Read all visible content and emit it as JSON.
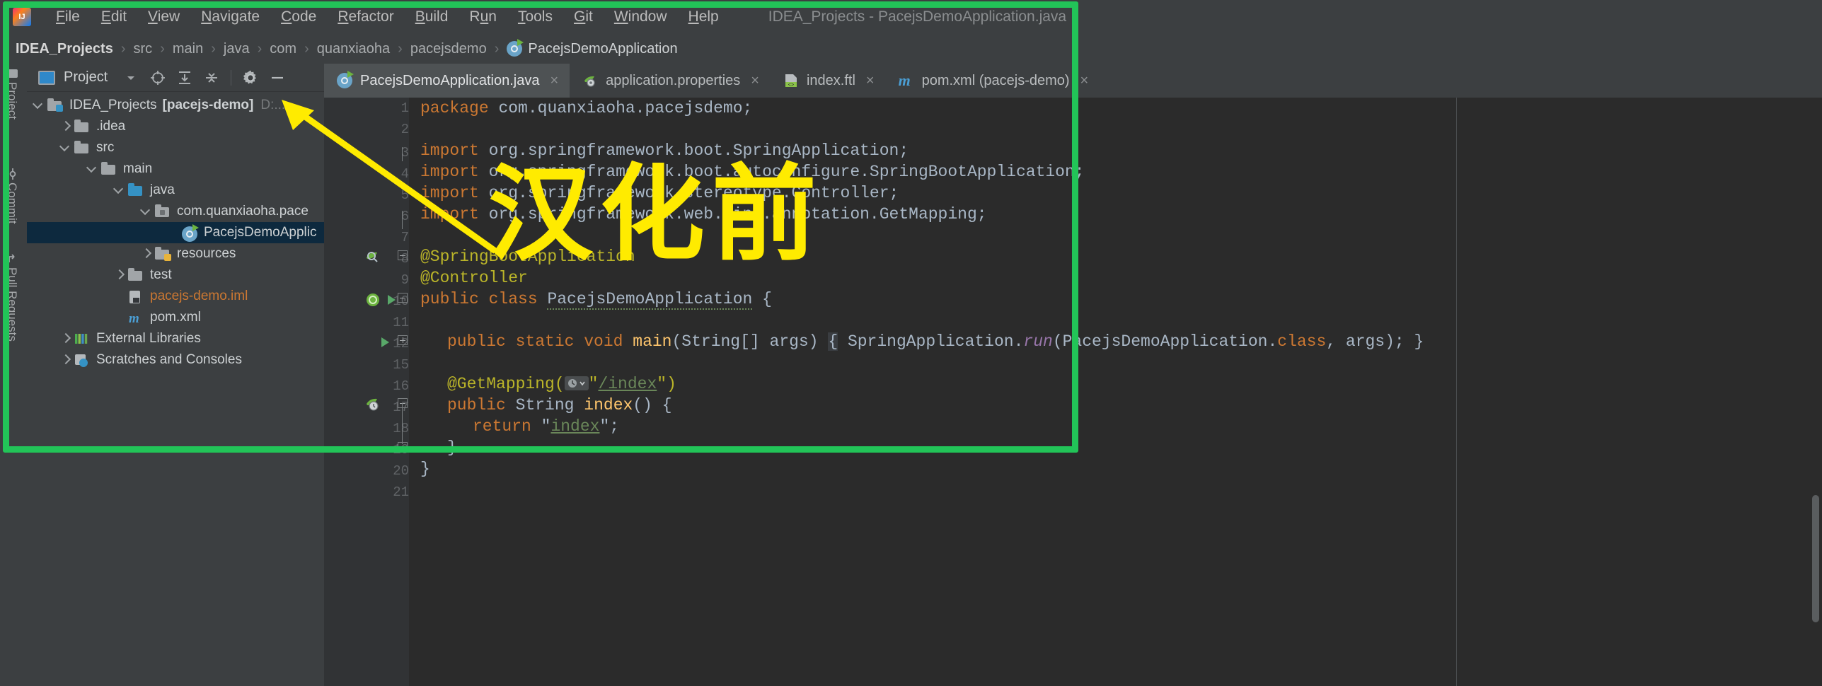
{
  "window": {
    "title": "IDEA_Projects - PacejsDemoApplication.java",
    "logo_text": "IJ"
  },
  "menubar": {
    "items": [
      {
        "label": "File",
        "mnemonic": "F"
      },
      {
        "label": "Edit",
        "mnemonic": "E"
      },
      {
        "label": "View",
        "mnemonic": "V"
      },
      {
        "label": "Navigate",
        "mnemonic": "N"
      },
      {
        "label": "Code",
        "mnemonic": "C"
      },
      {
        "label": "Refactor",
        "mnemonic": "R"
      },
      {
        "label": "Build",
        "mnemonic": "B"
      },
      {
        "label": "Run",
        "mnemonic": "u"
      },
      {
        "label": "Tools",
        "mnemonic": "T"
      },
      {
        "label": "Git",
        "mnemonic": "G"
      },
      {
        "label": "Window",
        "mnemonic": "W"
      },
      {
        "label": "Help",
        "mnemonic": "H"
      }
    ]
  },
  "breadcrumb": {
    "separator": "›",
    "items": [
      "IDEA_Projects",
      "src",
      "main",
      "java",
      "com",
      "quanxiaoha",
      "pacejsdemo",
      "PacejsDemoApplication"
    ]
  },
  "tool_strip": {
    "items": [
      "Project",
      "Commit",
      "Pull Requests"
    ]
  },
  "project_panel": {
    "title": "Project",
    "buttons": [
      "dropdown-arrow",
      "select-opened-file",
      "expand-all",
      "collapse-all",
      "settings-gear",
      "hide-panel"
    ],
    "tree": [
      {
        "label": "IDEA_Projects",
        "suffix": "[pacejs-demo]",
        "trail": "D:...",
        "depth": 0,
        "arrow": "down",
        "icon": "module-folder",
        "selected": false
      },
      {
        "label": ".idea",
        "depth": 1,
        "arrow": "right",
        "icon": "folder",
        "selected": false
      },
      {
        "label": "src",
        "depth": 1,
        "arrow": "down",
        "icon": "folder",
        "selected": false
      },
      {
        "label": "main",
        "depth": 2,
        "arrow": "down",
        "icon": "folder",
        "selected": false
      },
      {
        "label": "java",
        "depth": 3,
        "arrow": "down",
        "icon": "source-folder",
        "selected": false
      },
      {
        "label": "com.quanxiaoha.pace",
        "depth": 4,
        "arrow": "down",
        "icon": "package",
        "selected": false
      },
      {
        "label": "PacejsDemoApplic",
        "depth": 5,
        "arrow": "none",
        "icon": "spring-class",
        "selected": true
      },
      {
        "label": "resources",
        "depth": 4,
        "arrow": "right",
        "icon": "resources-folder",
        "selected": false
      },
      {
        "label": "test",
        "depth": 3,
        "arrow": "right",
        "icon": "folder",
        "selected": false
      },
      {
        "label": "pacejs-demo.iml",
        "depth": 3,
        "arrow": "none",
        "icon": "iml-file",
        "selected": false
      },
      {
        "label": "pom.xml",
        "depth": 3,
        "arrow": "none",
        "icon": "maven-file",
        "selected": false
      },
      {
        "label": "External Libraries",
        "depth": 1,
        "arrow": "right",
        "icon": "libraries",
        "selected": false
      },
      {
        "label": "Scratches and Consoles",
        "depth": 1,
        "arrow": "right",
        "icon": "scratches",
        "selected": false
      }
    ]
  },
  "editor": {
    "tabs": [
      {
        "label": "PacejsDemoApplication.java",
        "icon": "spring-class-icon",
        "active": true,
        "close": "×"
      },
      {
        "label": "application.properties",
        "icon": "spring-properties-icon",
        "active": false,
        "close": "×"
      },
      {
        "label": "index.ftl",
        "icon": "ftl-file-icon",
        "active": false,
        "close": "×"
      },
      {
        "label": "pom.xml (pacejs-demo)",
        "icon": "maven-icon",
        "active": false,
        "close": "×"
      }
    ],
    "line_numbers": [
      "1",
      "2",
      "3",
      "4",
      "5",
      "6",
      "7",
      "8",
      "9",
      "10",
      "11",
      "12",
      "15",
      "16",
      "17",
      "18",
      "19",
      "20",
      "21"
    ],
    "lines": [
      {
        "n": "1",
        "text": "package com.quanxiaoha.pacejsdemo;"
      },
      {
        "n": "2",
        "text": ""
      },
      {
        "n": "3",
        "text": "import org.springframework.boot.SpringApplication;"
      },
      {
        "n": "4",
        "text": "import org.springframework.boot.autoconfigure.SpringBootApplication;"
      },
      {
        "n": "5",
        "text": "import org.springframework.stereotype.Controller;"
      },
      {
        "n": "6",
        "text": "import org.springframework.web.bind.annotation.GetMapping;"
      },
      {
        "n": "7",
        "text": ""
      },
      {
        "n": "8",
        "text": "@SpringBootApplication"
      },
      {
        "n": "9",
        "text": "@Controller"
      },
      {
        "n": "10",
        "text": "public class PacejsDemoApplication {"
      },
      {
        "n": "11",
        "text": ""
      },
      {
        "n": "12",
        "text": "    public static void main(String[] args) { SpringApplication.run(PacejsDemoApplication.class, args); }"
      },
      {
        "n": "15",
        "text": ""
      },
      {
        "n": "16",
        "text": "    @GetMapping(\"/index\")"
      },
      {
        "n": "17",
        "text": "    public String index() {"
      },
      {
        "n": "18",
        "text": "        return \"index\";"
      },
      {
        "n": "19",
        "text": "    }"
      },
      {
        "n": "20",
        "text": "}"
      },
      {
        "n": "21",
        "text": ""
      }
    ]
  },
  "annotations": {
    "chinese_caption": "汉化前",
    "highlight_color": "#22c458",
    "arrow_color": "#ffeb00",
    "caption_color": "#ffeb00"
  }
}
